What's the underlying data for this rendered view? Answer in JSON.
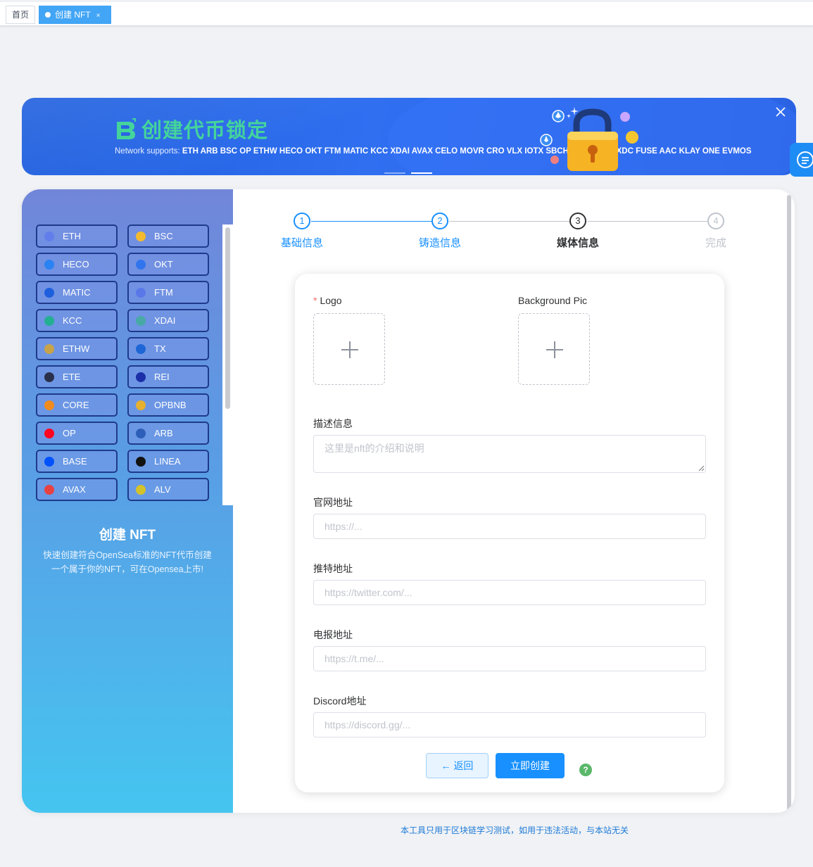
{
  "tabs": {
    "home": "首页",
    "active": "创建 NFT",
    "active_close": "×"
  },
  "banner": {
    "title": "创建代币锁定",
    "net_prefix": "Network supports:",
    "networks": "ETH ARB BSC OP ETHW HECO OKT FTM MATIC KCC XDAI AVAX CELO MOVR CRO VLX IOTX SBCH GLMR SDN XDC FUSE AAC KLAY ONE EVMOS"
  },
  "chains": [
    {
      "label": "ETH",
      "color": "#627eea"
    },
    {
      "label": "BSC",
      "color": "#f3ba2f"
    },
    {
      "label": "HECO",
      "color": "#2a82f3"
    },
    {
      "label": "OKT",
      "color": "#3075ee"
    },
    {
      "label": "MATIC",
      "color": "#1e5fdd"
    },
    {
      "label": "FTM",
      "color": "#5a78e8"
    },
    {
      "label": "KCC",
      "color": "#23af91"
    },
    {
      "label": "XDAI",
      "color": "#48a9a6"
    },
    {
      "label": "ETHW",
      "color": "#c8a34a"
    },
    {
      "label": "TX",
      "color": "#1e66d6"
    },
    {
      "label": "ETE",
      "color": "#2a2f4a"
    },
    {
      "label": "REI",
      "color": "#1a2fa8"
    },
    {
      "label": "CORE",
      "color": "#f28b1e"
    },
    {
      "label": "OPBNB",
      "color": "#e6b030"
    },
    {
      "label": "OP",
      "color": "#ff0420"
    },
    {
      "label": "ARB",
      "color": "#2d5fb8"
    },
    {
      "label": "BASE",
      "color": "#0052ff"
    },
    {
      "label": "LINEA",
      "color": "#121212"
    },
    {
      "label": "AVAX",
      "color": "#e84142"
    },
    {
      "label": "ALV",
      "color": "#d4c22a"
    }
  ],
  "left": {
    "title": "创建 NFT",
    "desc": "快速创建符合OpenSea标准的NFT代币创建一个属于你的NFT，可在Opensea上市!"
  },
  "steps": [
    {
      "num": "1",
      "label": "基础信息",
      "state": "done"
    },
    {
      "num": "2",
      "label": "铸造信息",
      "state": "done"
    },
    {
      "num": "3",
      "label": "媒体信息",
      "state": "cur"
    },
    {
      "num": "4",
      "label": "完成",
      "state": "wait"
    }
  ],
  "form": {
    "logo_label": "Logo",
    "required_mark": "*",
    "bg_label": "Background Pic",
    "desc_label": "描述信息",
    "desc_placeholder": "这里是nft的介绍和说明",
    "site_label": "官网地址",
    "site_placeholder": "https://...",
    "twitter_label": "推特地址",
    "twitter_placeholder": "https://twitter.com/...",
    "telegram_label": "电报地址",
    "telegram_placeholder": "https://t.me/...",
    "discord_label": "Discord地址",
    "discord_placeholder": "https://discord.gg/...",
    "back_label": "返回",
    "back_arrow": "←",
    "create_label": "立即创建",
    "help": "?"
  },
  "footer": "本工具只用于区块链学习测试，如用于违法活动，与本站无关"
}
